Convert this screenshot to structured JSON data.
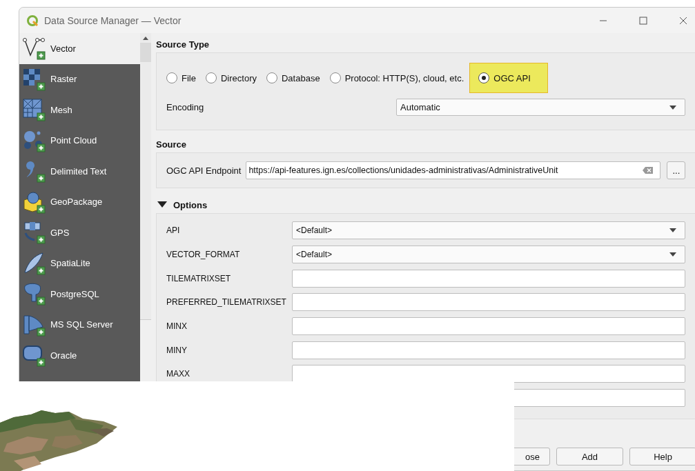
{
  "window": {
    "title": "Data Source Manager — Vector"
  },
  "sidebar": {
    "items": [
      {
        "label": "Vector",
        "selected": true
      },
      {
        "label": "Raster",
        "selected": false
      },
      {
        "label": "Mesh",
        "selected": false
      },
      {
        "label": "Point Cloud",
        "selected": false
      },
      {
        "label": "Delimited Text",
        "selected": false
      },
      {
        "label": "GeoPackage",
        "selected": false
      },
      {
        "label": "GPS",
        "selected": false
      },
      {
        "label": "SpatiaLite",
        "selected": false
      },
      {
        "label": "PostgreSQL",
        "selected": false
      },
      {
        "label": "MS SQL Server",
        "selected": false
      },
      {
        "label": "Oracle",
        "selected": false
      }
    ]
  },
  "source_type": {
    "title": "Source Type",
    "options": [
      {
        "label": "File",
        "selected": false,
        "highlighted": false
      },
      {
        "label": "Directory",
        "selected": false,
        "highlighted": false
      },
      {
        "label": "Database",
        "selected": false,
        "highlighted": false
      },
      {
        "label": "Protocol: HTTP(S), cloud, etc.",
        "selected": false,
        "highlighted": false
      },
      {
        "label": "OGC API",
        "selected": true,
        "highlighted": true
      }
    ],
    "encoding": {
      "label": "Encoding",
      "value": "Automatic"
    }
  },
  "source": {
    "title": "Source",
    "endpoint": {
      "label": "OGC API Endpoint",
      "value": "https://api-features.ign.es/collections/unidades-administrativas/AdministrativeUnit"
    },
    "browse_button": "..."
  },
  "options": {
    "title": "Options",
    "expanded": true,
    "rows": [
      {
        "label": "API",
        "kind": "combo",
        "value": "<Default>"
      },
      {
        "label": "VECTOR_FORMAT",
        "kind": "combo",
        "value": "<Default>"
      },
      {
        "label": "TILEMATRIXSET",
        "kind": "field"
      },
      {
        "label": "PREFERRED_TILEMATRIXSET",
        "kind": "field"
      },
      {
        "label": "MINX",
        "kind": "field"
      },
      {
        "label": "MINY",
        "kind": "field"
      },
      {
        "label": "MAXX",
        "kind": "field"
      },
      {
        "kind": "field"
      }
    ]
  },
  "buttons": [
    {
      "label": "ose"
    },
    {
      "label": "Add"
    },
    {
      "label": "Help"
    }
  ]
}
